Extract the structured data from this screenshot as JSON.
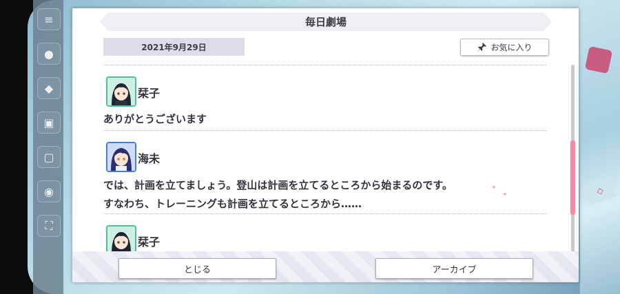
{
  "dialog": {
    "title": "毎日劇場",
    "date": "2021年9月29日",
    "favorite_label": "お気に入り"
  },
  "entries": [
    {
      "speaker": "栞子",
      "avatar_icon": "character-avatar-icon",
      "lines": [
        "ありがとうございます"
      ]
    },
    {
      "speaker": "海未",
      "avatar_icon": "character-avatar-icon",
      "lines": [
        "では、計画を立てましょう。登山は計画を立てるところから始まるのです。",
        "すなわち、トレーニングも計画を立てるところから……"
      ]
    },
    {
      "speaker": "栞子",
      "avatar_icon": "character-avatar-icon",
      "lines": []
    }
  ],
  "buttons": {
    "close_label": "とじる",
    "archive_label": "アーカイブ"
  },
  "colors": {
    "accent_pink": "#f48aa5",
    "avatar_green": "#4fbf9a",
    "avatar_blue": "#4c78d6"
  }
}
